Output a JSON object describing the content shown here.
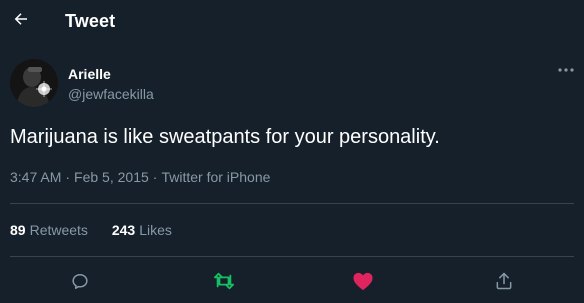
{
  "header": {
    "title": "Tweet",
    "back_icon": "arrow-left-icon"
  },
  "tweet": {
    "author_name": "Arielle",
    "author_handle": "@jewfacekilla",
    "text": "Marijuana is like sweatpants for your personality.",
    "time": "3:47 AM",
    "date": "Feb 5, 2015",
    "source": "Twitter for iPhone",
    "separator": "·"
  },
  "stats": {
    "retweets_count": "89",
    "retweets_label": "Retweets",
    "likes_count": "243",
    "likes_label": "Likes"
  },
  "actions": [
    {
      "name": "reply",
      "icon": "reply-icon",
      "color": "#8899a6"
    },
    {
      "name": "retweet",
      "icon": "retweet-icon",
      "color": "#17bf63"
    },
    {
      "name": "like",
      "icon": "heart-icon",
      "color": "#e0245e"
    },
    {
      "name": "share",
      "icon": "share-icon",
      "color": "#8899a6"
    }
  ],
  "colors": {
    "background": "#15202b",
    "text_primary": "#ffffff",
    "text_secondary": "#8899a6",
    "divider": "#38444d",
    "retweet_green": "#17bf63",
    "like_pink": "#e0245e"
  }
}
